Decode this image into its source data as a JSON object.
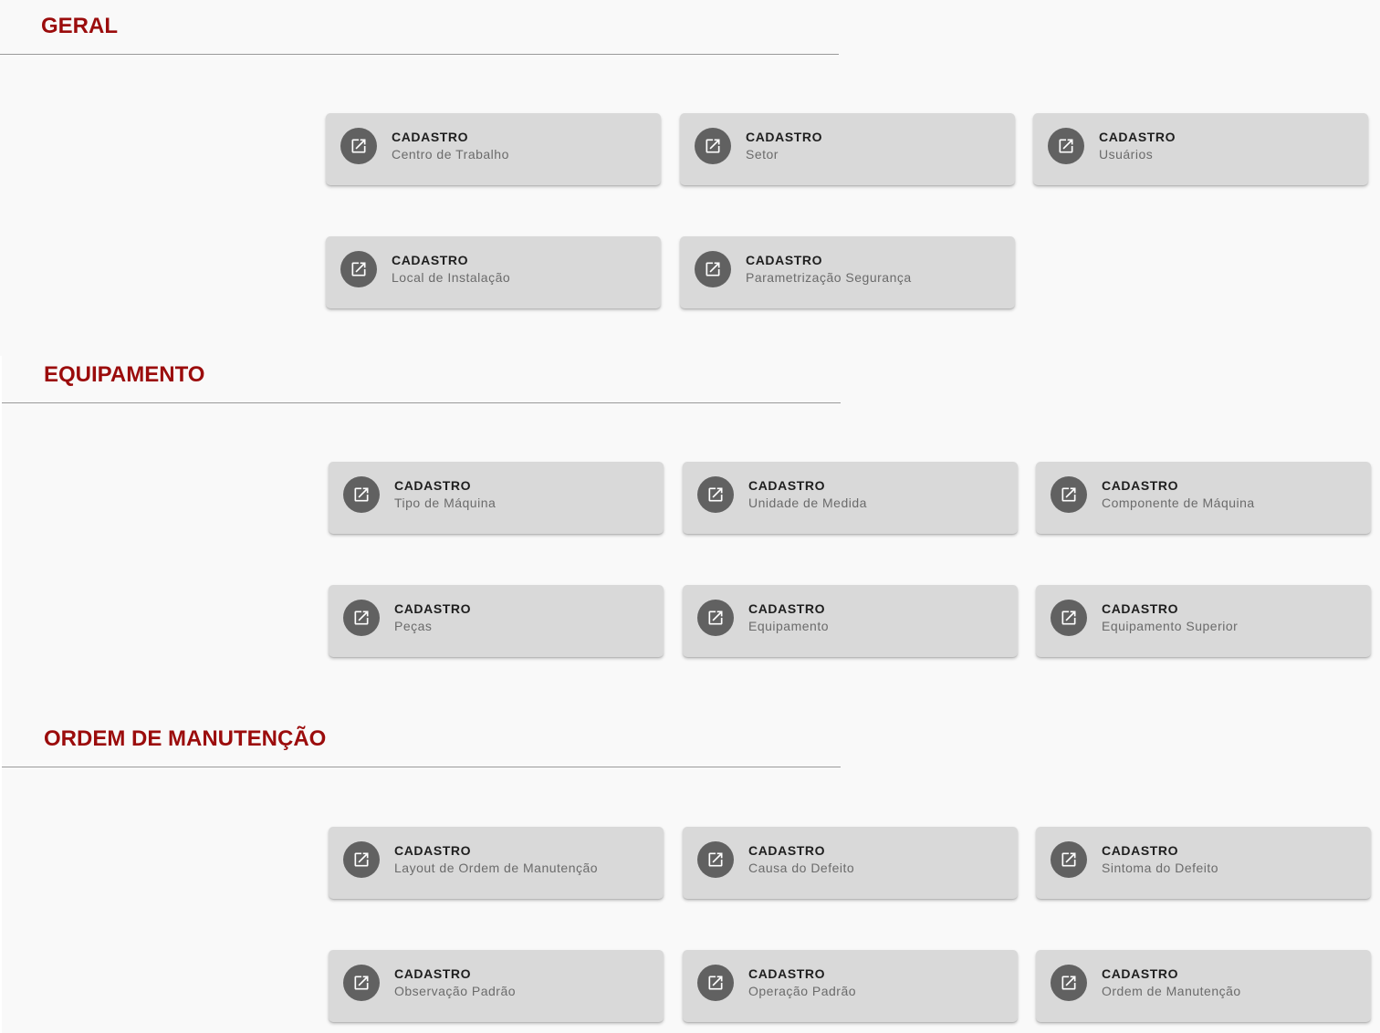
{
  "colors": {
    "section_title": "#9b0c0c",
    "card_background": "#d9d9d9",
    "card_title": "#1e1e1e",
    "card_subtitle": "#6b6b6b",
    "icon_circle": "#616161",
    "icon_glyph": "#ffffff"
  },
  "sections": [
    {
      "title": "GERAL",
      "cards": [
        {
          "title": "CADASTRO",
          "subtitle": "Centro de Trabalho",
          "icon": "open-in-new-icon"
        },
        {
          "title": "CADASTRO",
          "subtitle": "Setor",
          "icon": "open-in-new-icon"
        },
        {
          "title": "CADASTRO",
          "subtitle": "Usuários",
          "icon": "open-in-new-icon"
        },
        {
          "title": "CADASTRO",
          "subtitle": "Local de Instalação",
          "icon": "open-in-new-icon"
        },
        {
          "title": "CADASTRO",
          "subtitle": "Parametrização Segurança",
          "icon": "open-in-new-icon"
        }
      ]
    },
    {
      "title": "EQUIPAMENTO",
      "cards": [
        {
          "title": "CADASTRO",
          "subtitle": "Tipo de Máquina",
          "icon": "open-in-new-icon"
        },
        {
          "title": "CADASTRO",
          "subtitle": "Unidade de Medida",
          "icon": "open-in-new-icon"
        },
        {
          "title": "CADASTRO",
          "subtitle": "Componente de Máquina",
          "icon": "open-in-new-icon"
        },
        {
          "title": "CADASTRO",
          "subtitle": "Peças",
          "icon": "open-in-new-icon"
        },
        {
          "title": "CADASTRO",
          "subtitle": "Equipamento",
          "icon": "open-in-new-icon"
        },
        {
          "title": "CADASTRO",
          "subtitle": "Equipamento Superior",
          "icon": "open-in-new-icon"
        }
      ]
    },
    {
      "title": "ORDEM DE MANUTENÇÃO",
      "cards": [
        {
          "title": "CADASTRO",
          "subtitle": "Layout de Ordem de Manutenção",
          "icon": "open-in-new-icon"
        },
        {
          "title": "CADASTRO",
          "subtitle": "Causa do Defeito",
          "icon": "open-in-new-icon"
        },
        {
          "title": "CADASTRO",
          "subtitle": "Sintoma do Defeito",
          "icon": "open-in-new-icon"
        },
        {
          "title": "CADASTRO",
          "subtitle": "Observação Padrão",
          "icon": "open-in-new-icon"
        },
        {
          "title": "CADASTRO",
          "subtitle": "Operação Padrão",
          "icon": "open-in-new-icon"
        },
        {
          "title": "CADASTRO",
          "subtitle": "Ordem de Manutenção",
          "icon": "open-in-new-icon"
        }
      ]
    }
  ]
}
